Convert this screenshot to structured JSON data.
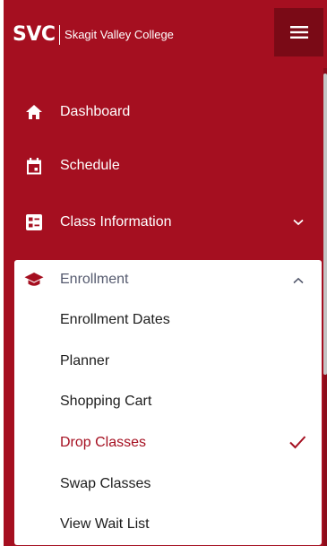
{
  "header": {
    "logo_mark": "SVC",
    "logo_name": "Skagit Valley College",
    "menu_icon": "hamburger-menu-icon"
  },
  "nav": {
    "items": [
      {
        "label": "Dashboard",
        "icon": "home-icon"
      },
      {
        "label": "Schedule",
        "icon": "calendar-icon"
      },
      {
        "label": "Class Information",
        "icon": "list-card-icon",
        "expanded": false
      }
    ],
    "enrollment": {
      "label": "Enrollment",
      "icon": "graduation-cap-icon",
      "expanded": true,
      "items": [
        {
          "label": "Enrollment Dates",
          "active": false
        },
        {
          "label": "Planner",
          "active": false
        },
        {
          "label": "Shopping Cart",
          "active": false
        },
        {
          "label": "Drop Classes",
          "active": true
        },
        {
          "label": "Swap Classes",
          "active": false
        },
        {
          "label": "View Wait List",
          "active": false
        }
      ]
    }
  },
  "colors": {
    "brand_red": "#a50f20",
    "menu_button_dark_red": "#7a0a16",
    "enrollment_label": "#555a6e",
    "text_dark": "#1d1d1d"
  }
}
